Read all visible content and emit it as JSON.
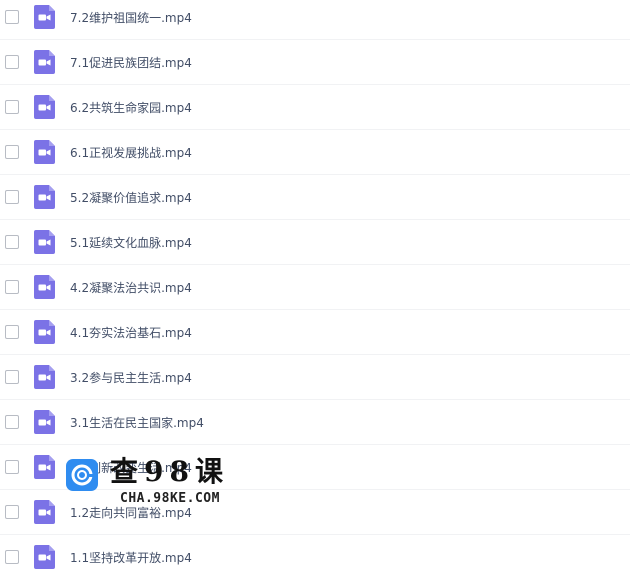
{
  "files": [
    {
      "name": "7.2维护祖国统一.mp4",
      "icon": "video-file-icon"
    },
    {
      "name": "7.1促进民族团结.mp4",
      "icon": "video-file-icon"
    },
    {
      "name": "6.2共筑生命家园.mp4",
      "icon": "video-file-icon"
    },
    {
      "name": "6.1正视发展挑战.mp4",
      "icon": "video-file-icon"
    },
    {
      "name": "5.2凝聚价值追求.mp4",
      "icon": "video-file-icon"
    },
    {
      "name": "5.1延续文化血脉.mp4",
      "icon": "video-file-icon"
    },
    {
      "name": "4.2凝聚法治共识.mp4",
      "icon": "video-file-icon"
    },
    {
      "name": "4.1夯实法治基石.mp4",
      "icon": "video-file-icon"
    },
    {
      "name": "3.2参与民主生活.mp4",
      "icon": "video-file-icon"
    },
    {
      "name": "3.1生活在民主国家.mp4",
      "icon": "video-file-icon"
    },
    {
      "name": "2.2创新改变生活.mp4",
      "icon": "video-file-icon"
    },
    {
      "name": "1.2走向共同富裕.mp4",
      "icon": "video-file-icon"
    },
    {
      "name": "1.1坚持改革开放.mp4",
      "icon": "video-file-icon"
    }
  ],
  "watermark": {
    "cn_text": "查98课",
    "en_text": "CHA.98KE.COM"
  },
  "colors": {
    "icon_bg": "#7b72e6",
    "text": "#424e67",
    "row_border": "#f1f2f4",
    "logo_bg": "#2f8cf0"
  }
}
